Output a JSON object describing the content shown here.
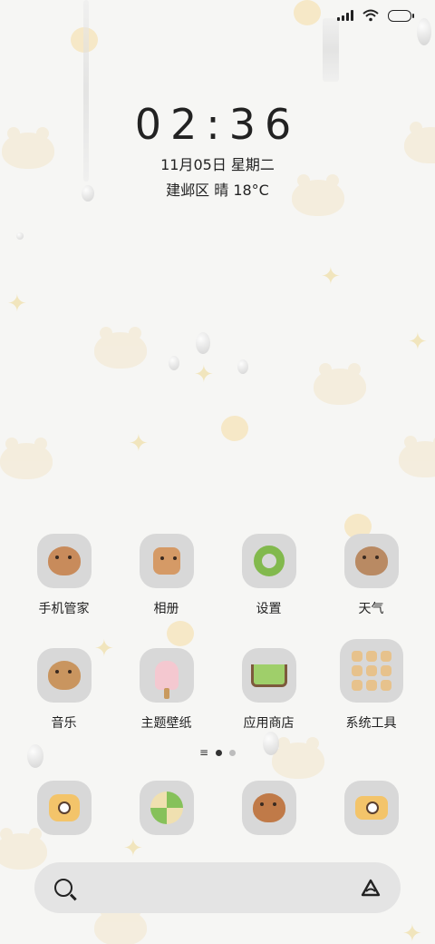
{
  "status_bar": {
    "signal_icon": "signal-icon",
    "wifi_icon": "wifi-icon",
    "battery_icon": "battery-icon"
  },
  "lockclock": {
    "time": "02:36",
    "date": "11月05日 星期二",
    "weather": "建邺区 晴 18°C"
  },
  "apps": [
    {
      "label": "手机管家",
      "icon": "capybara-shield-icon"
    },
    {
      "label": "相册",
      "icon": "photo-album-icon"
    },
    {
      "label": "设置",
      "icon": "settings-donut-icon"
    },
    {
      "label": "天气",
      "icon": "weather-capybara-icon"
    },
    {
      "label": "音乐",
      "icon": "music-capybara-icon"
    },
    {
      "label": "主题壁纸",
      "icon": "popsicle-theme-icon"
    },
    {
      "label": "应用商店",
      "icon": "shopping-cart-icon"
    },
    {
      "label": "系统工具",
      "icon": "tools-folder-icon"
    }
  ],
  "pager": {
    "pages": 2,
    "active": 1
  },
  "dock": [
    {
      "icon": "camera-icon"
    },
    {
      "icon": "browser-globe-icon"
    },
    {
      "icon": "messages-capybara-icon"
    },
    {
      "icon": "phone-radio-icon"
    }
  ],
  "search": {
    "search_icon": "search-icon",
    "assistant_icon": "assistant-icon"
  }
}
